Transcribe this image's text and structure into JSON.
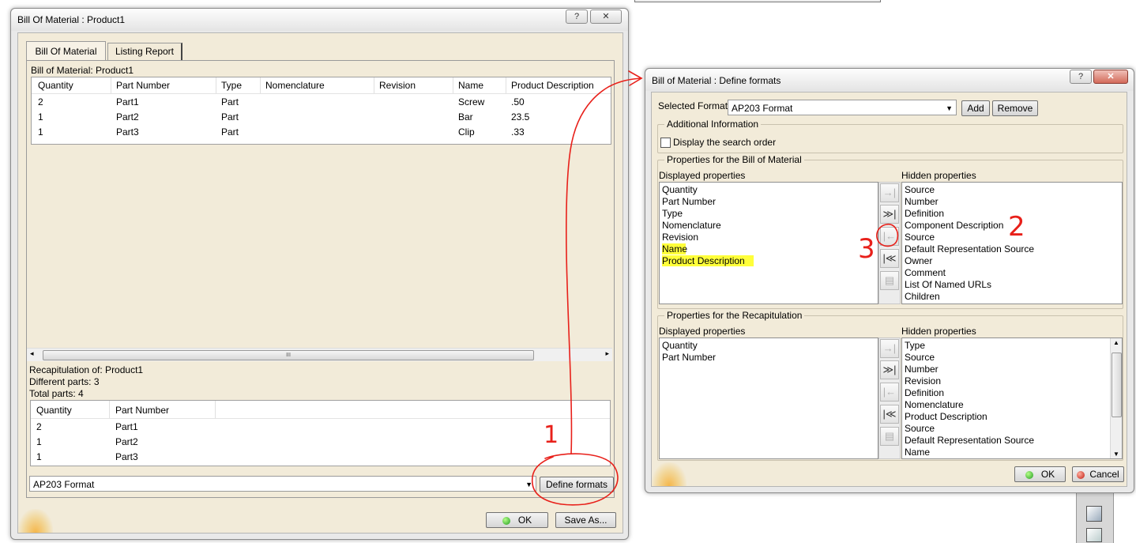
{
  "left_dialog": {
    "title": "Bill Of Material : Product1",
    "help_button": "?",
    "close_button": "✕",
    "tabs": [
      {
        "label": "Bill Of Material",
        "selected": true
      },
      {
        "label": "Listing Report",
        "selected": false
      }
    ],
    "bom": {
      "caption": "Bill of Material: Product1",
      "columns": [
        "Quantity",
        "Part Number",
        "Type",
        "Nomenclature",
        "Revision",
        "Name",
        "Product Description"
      ],
      "rows": [
        [
          "2",
          "Part1",
          "Part",
          "",
          "",
          "Screw",
          ".50"
        ],
        [
          "1",
          "Part2",
          "Part",
          "",
          "",
          "Bar",
          "23.5"
        ],
        [
          "1",
          "Part3",
          "Part",
          "",
          "",
          "Clip",
          ".33"
        ]
      ]
    },
    "hscroll_grip": "III",
    "recap": {
      "title": "Recapitulation of: Product1",
      "different_parts": "Different parts: 3",
      "total_parts": "Total parts: 4",
      "columns": [
        "Quantity",
        "Part Number"
      ],
      "rows": [
        [
          "2",
          "Part1"
        ],
        [
          "1",
          "Part2"
        ],
        [
          "1",
          "Part3"
        ]
      ]
    },
    "format_select": "AP203 Format",
    "define_formats_button": "Define formats",
    "ok_button": "OK",
    "save_as_button": "Save As..."
  },
  "right_dialog": {
    "title": "Bill of Material : Define formats",
    "help_button": "?",
    "close_button": "✕",
    "selected_format_label": "Selected Format",
    "selected_format_value": "AP203 Format",
    "add_button": "Add",
    "remove_button": "Remove",
    "additional_info_label": "Additional Information",
    "display_search_order_label": "Display the search order",
    "display_search_order_checked": false,
    "bom_props": {
      "group_label": "Properties for the Bill of Material",
      "displayed_label": "Displayed properties",
      "hidden_label": "Hidden properties",
      "displayed": [
        "Quantity",
        "Part Number",
        "Type",
        "Nomenclature",
        "Revision",
        "Name",
        "Product Description"
      ],
      "highlighted": [
        "Name",
        "Product Description"
      ],
      "hidden": [
        "Source",
        "Number",
        "Definition",
        "Component Description",
        "Source",
        "Default Representation Source",
        "Owner",
        "Comment",
        "List Of Named URLs",
        "Children"
      ]
    },
    "recap_props": {
      "group_label": "Properties for the Recapitulation",
      "displayed_label": "Displayed properties",
      "hidden_label": "Hidden properties",
      "displayed": [
        "Quantity",
        "Part Number"
      ],
      "hidden": [
        "Type",
        "Source",
        "Number",
        "Revision",
        "Definition",
        "Nomenclature",
        "Product Description",
        "Source",
        "Default Representation Source",
        "Name"
      ]
    },
    "ok_button": "OK",
    "cancel_button": "Cancel"
  },
  "arrow_icons": {
    "move_right": "→|",
    "move_all_right": "≫|",
    "move_left": "|←",
    "move_all_left": "|≪",
    "sort": "▤"
  },
  "annotations": {
    "label_1": "1",
    "label_2": "2",
    "label_3": "3",
    "ink_color": "#e8201a",
    "highlight_color": "#ffff3a"
  }
}
